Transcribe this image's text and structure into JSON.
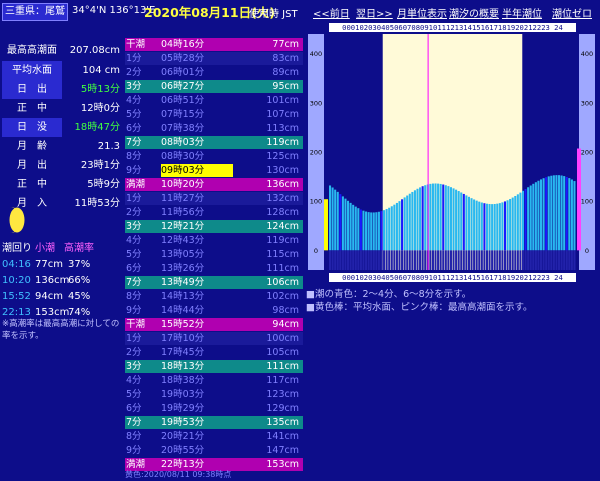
{
  "header": {
    "location": "三重県：尾鷲",
    "coords": "34°4'N 136°13'E",
    "date": "2020年08月11日(火)",
    "timezone": "使用時 JST",
    "nav": [
      "<<前日",
      "翌日>>",
      "月単位表示",
      "潮汐の概要",
      "半年潮位",
      "潮位ゼロ"
    ]
  },
  "info": [
    {
      "label": "最高高潮面",
      "value": "207.08cm",
      "style": "dark",
      "color": "#ffffff"
    },
    {
      "label": "平均水面",
      "value": "104 cm",
      "style": "blue",
      "color": "#ffffff"
    },
    {
      "label": "日　出",
      "value": "5時13分",
      "style": "blue",
      "color": "#40ff40"
    },
    {
      "label": "正　中",
      "value": "12時0分",
      "style": "dark",
      "color": "#ffffff"
    },
    {
      "label": "日　没",
      "value": "18時47分",
      "style": "blue",
      "color": "#40ff40"
    },
    {
      "label": "月　齢",
      "value": "21.3",
      "style": "dark",
      "color": "#ffffff"
    },
    {
      "label": "月　出",
      "value": "23時1分",
      "style": "dark",
      "color": "#ffffff"
    },
    {
      "label": "正　中",
      "value": "5時9分",
      "style": "dark",
      "color": "#ffffff"
    },
    {
      "label": "月　入",
      "value": "11時53分",
      "style": "dark",
      "color": "#ffffff"
    }
  ],
  "tide_summary": {
    "headers": [
      "潮回り",
      "小潮",
      "高潮率"
    ],
    "rows": [
      {
        "time": "04:16",
        "height": "77cm",
        "rate": "37%"
      },
      {
        "time": "10:20",
        "height": "136cm",
        "rate": "66%"
      },
      {
        "time": "15:52",
        "height": "94cm",
        "rate": "45%"
      },
      {
        "time": "22:13",
        "height": "153cm",
        "rate": "74%"
      }
    ],
    "note": "※高潮率は最高高潮に対しての率を示す。"
  },
  "table": [
    {
      "c1": "干潮",
      "c2": "04時16分",
      "c3": "77cm",
      "style": "event"
    },
    {
      "c1": "1分",
      "c2": "05時28分",
      "c3": "83cm",
      "style": "blue"
    },
    {
      "c1": "2分",
      "c2": "06時01分",
      "c3": "89cm",
      "style": "dark"
    },
    {
      "c1": "3分",
      "c2": "06時27分",
      "c3": "95cm",
      "style": "teal"
    },
    {
      "c1": "4分",
      "c2": "06時51分",
      "c3": "101cm",
      "style": "dark"
    },
    {
      "c1": "5分",
      "c2": "07時15分",
      "c3": "107cm",
      "style": "dark"
    },
    {
      "c1": "6分",
      "c2": "07時38分",
      "c3": "113cm",
      "style": "dark"
    },
    {
      "c1": "7分",
      "c2": "08時03分",
      "c3": "119cm",
      "style": "teal"
    },
    {
      "c1": "8分",
      "c2": "08時30分",
      "c3": "125cm",
      "style": "dark"
    },
    {
      "c1": "9分",
      "c2": "09時03分",
      "c3": "130cm",
      "style": "dark",
      "hl": true
    },
    {
      "c1": "満潮",
      "c2": "10時20分",
      "c3": "136cm",
      "style": "event"
    },
    {
      "c1": "1分",
      "c2": "11時27分",
      "c3": "132cm",
      "style": "blue"
    },
    {
      "c1": "2分",
      "c2": "11時56分",
      "c3": "128cm",
      "style": "dark"
    },
    {
      "c1": "3分",
      "c2": "12時21分",
      "c3": "124cm",
      "style": "teal"
    },
    {
      "c1": "4分",
      "c2": "12時43分",
      "c3": "119cm",
      "style": "dark"
    },
    {
      "c1": "5分",
      "c2": "13時05分",
      "c3": "115cm",
      "style": "dark"
    },
    {
      "c1": "6分",
      "c2": "13時26分",
      "c3": "111cm",
      "style": "dark"
    },
    {
      "c1": "7分",
      "c2": "13時49分",
      "c3": "106cm",
      "style": "teal"
    },
    {
      "c1": "8分",
      "c2": "14時13分",
      "c3": "102cm",
      "style": "dark"
    },
    {
      "c1": "9分",
      "c2": "14時44分",
      "c3": "98cm",
      "style": "dark"
    },
    {
      "c1": "干潮",
      "c2": "15時52分",
      "c3": "94cm",
      "style": "event"
    },
    {
      "c1": "1分",
      "c2": "17時10分",
      "c3": "100cm",
      "style": "blue"
    },
    {
      "c1": "2分",
      "c2": "17時45分",
      "c3": "105cm",
      "style": "dark"
    },
    {
      "c1": "3分",
      "c2": "18時13分",
      "c3": "111cm",
      "style": "teal"
    },
    {
      "c1": "4分",
      "c2": "18時38分",
      "c3": "117cm",
      "style": "dark"
    },
    {
      "c1": "5分",
      "c2": "19時03分",
      "c3": "123cm",
      "style": "dark"
    },
    {
      "c1": "6分",
      "c2": "19時29分",
      "c3": "129cm",
      "style": "dark"
    },
    {
      "c1": "7分",
      "c2": "19時53分",
      "c3": "135cm",
      "style": "teal"
    },
    {
      "c1": "8分",
      "c2": "20時21分",
      "c3": "141cm",
      "style": "dark"
    },
    {
      "c1": "9分",
      "c2": "20時55分",
      "c3": "147cm",
      "style": "dark"
    },
    {
      "c1": "満潮",
      "c2": "22時13分",
      "c3": "153cm",
      "style": "event"
    }
  ],
  "footer_note": "黄色:2020/08/11 09:38時点",
  "legend_notes": [
    "■潮の青色：2～4分、6～8分を示す。",
    "■黄色棒：平均水面、ピンク棒：最高高潮面を示す。"
  ],
  "chart_data": {
    "type": "bar",
    "title": "",
    "xlabel": "",
    "ylabel": "",
    "hour_labels": [
      "00",
      "01",
      "02",
      "03",
      "04",
      "05",
      "06",
      "07",
      "08",
      "09",
      "10",
      "11",
      "12",
      "13",
      "14",
      "15",
      "16",
      "17",
      "18",
      "19",
      "20",
      "21",
      "22",
      "23",
      "24"
    ],
    "hour_label_text": "000102030405060708091011121314151617181920212223 24",
    "yticks": [
      0,
      100,
      200,
      300,
      400
    ],
    "ylim": [
      -40,
      440
    ],
    "daylight": [
      5.22,
      18.78
    ],
    "mean_level_cm": 104,
    "max_level_cm": 207.08,
    "current_time": 9.63,
    "tide_extremes": [
      {
        "t": 4.27,
        "h": 77
      },
      {
        "t": 10.33,
        "h": 136
      },
      {
        "t": 15.87,
        "h": 94
      },
      {
        "t": 22.22,
        "h": 153
      }
    ],
    "colors": {
      "bg": "#0d0d8a",
      "day": "#fffad8",
      "bar": "#29b8f0",
      "bar_dark": "#1a1aff",
      "mean": "#ffff00",
      "max": "#ff40ff",
      "grid": "#000000"
    }
  }
}
